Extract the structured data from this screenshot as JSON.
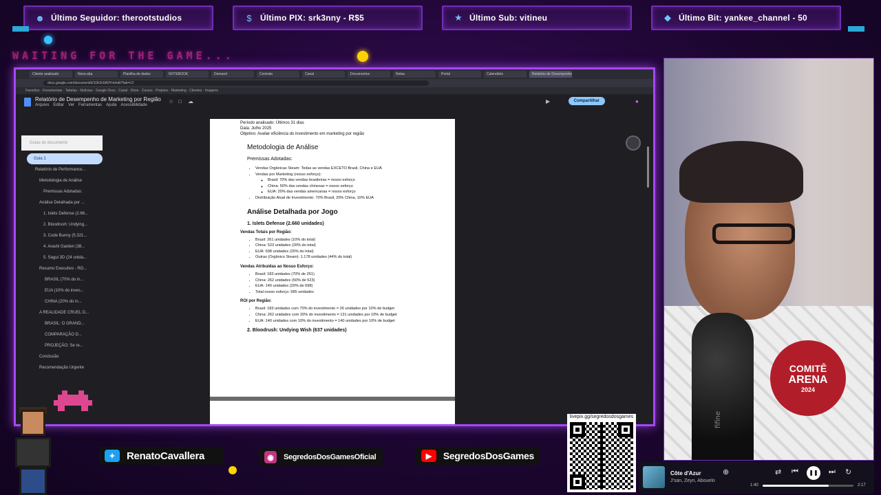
{
  "alerts": {
    "follower": {
      "label": "Último Seguidor: therootstudios",
      "icon": "user-icon"
    },
    "pix": {
      "label": "Último PIX: srk3nny - R$5",
      "icon": "dollar-icon"
    },
    "sub": {
      "label": "Último Sub: vitineu",
      "icon": "star-icon"
    },
    "bit": {
      "label": "Último Bit: yankee_channel - 50",
      "icon": "diamond-icon"
    }
  },
  "waiting_text": "WAITING FOR THE GAME...",
  "browser": {
    "tabs": [
      "Cliente analisado",
      "Nova aba",
      "Planilha de dados",
      "NOTEBOOK",
      "Demand",
      "Contrato",
      "Canal",
      "Documentos",
      "Notas",
      "Portal",
      "Calendário",
      "Relatório de Desempenho"
    ],
    "url": "docs.google.com/document/d/1Dk3c6A9Ym/edit?tab=t.0",
    "bookmarks": "Favoritos · Ferramentas · Tabelas · Notícias · Google Docs · Canal · Drive · Cursos · Projetos · Marketing · Clientes · Imagens"
  },
  "doc": {
    "title": "Relatório de Desempenho de Marketing por Região",
    "menu": [
      "Arquivo",
      "Editar",
      "Ver",
      "Ferramentas",
      "Ajuda",
      "Acessibilidade"
    ],
    "share_label": "Compartilhar",
    "outline_search": "Guias do documento",
    "outline_tab": "Guia 1",
    "outline": [
      "Relatório de Performance...",
      "Metodologia de Análise",
      "Premissas Adotadas:",
      "Análise Detalhada por ...",
      "1. Islets Defense (2.66...",
      "2. Bloodrush: Undying...",
      "3. Code Bunny (5.321...",
      "4. Arashi Garden (38...",
      "5. Sagui 3D (24 unida...",
      "Resumo Executivo - RO...",
      "BRASIL (70% do in...",
      "EUA (10% do inves...",
      "CHINA (20% do in...",
      "A REALIDADE CRUEL D...",
      "BRASIL: O GRAND...",
      "COMPARAÇÃO D...",
      "PROJEÇÃO: Se re...",
      "Conclusão",
      "Recomendação Urgente"
    ],
    "page": {
      "meta1": "Período analisado: Últimos 31 dias",
      "meta2": "Data: Julho 2025",
      "meta3": "Objetivo: Avaliar eficiência do investimento em marketing por região",
      "h_method": "Metodologia de Análise",
      "h_premissas": "Premissas Adotadas:",
      "premissas": [
        "Vendas Orgânicas Steam: Todas as vendas EXCETO Brasil, China e EUA",
        "Vendas por Marketing (nosso esforço):"
      ],
      "sub_premissas": [
        "Brasil: 70% das vendas brasileiras = nosso esforço",
        "China: 50% das vendas chinesas = nosso esforço",
        "EUA: 20% das vendas americanas = nosso esforço"
      ],
      "distribuicao": "Distribuição Atual de Investimento: 70% Brasil, 20% China, 10% EUA",
      "h_analise": "Análise Detalhada por Jogo",
      "h_game1": "1. Islets Defense (2.660 unidades)",
      "h_totais": "Vendas Totais por Região:",
      "totais": [
        "Brasil: 261 unidades (10% do total)",
        "China: 523 unidades (20% do total)",
        "EUA: 698 unidades (26% do total)",
        "Outras (Orgânico Steam): 1.178 unidades (44% do total)"
      ],
      "h_atribuidas": "Vendas Atribuídas ao Nosso Esforço:",
      "atribuidas": [
        "Brasil: 183 unidades (70% de 261)",
        "China: 262 unidades (50% de 523)",
        "EUA: 140 unidades (20% de 698)",
        "Total nosso esforço: 585 unidades"
      ],
      "h_roi": "ROI por Região:",
      "roi": [
        "Brasil: 183 unidades com 70% do investimento = 26 unidades por 10% de budget",
        "China: 262 unidades com 20% do investimento = 131 unidades por 10% de budget",
        "EUA: 140 unidades com 10% do investimento = 140 unidades por 10% de budget"
      ],
      "h_game2": "2. Bloodrush: Undying Wish (637 unidades)"
    }
  },
  "webcam": {
    "badge_l1": "COMITÊ",
    "badge_l2": "ARENA",
    "badge_l3": "2024",
    "mic_brand": "fifine"
  },
  "socials": {
    "twitter": "RenatoCavallera",
    "instagram": "SegredosDosGamesOficial",
    "youtube": "SegredosDosGames"
  },
  "qr_link": "livepix.gg/segredosdosgames",
  "music": {
    "title": "Côte d'Azur",
    "artist": "J'san, Zeyn, Abouelo",
    "elapsed": "1:40",
    "duration": "2:17",
    "progress": 0.73
  },
  "colors": {
    "frame": "#a448ff",
    "accent_blue": "#2aa9d6",
    "pink": "#ff3db8"
  }
}
